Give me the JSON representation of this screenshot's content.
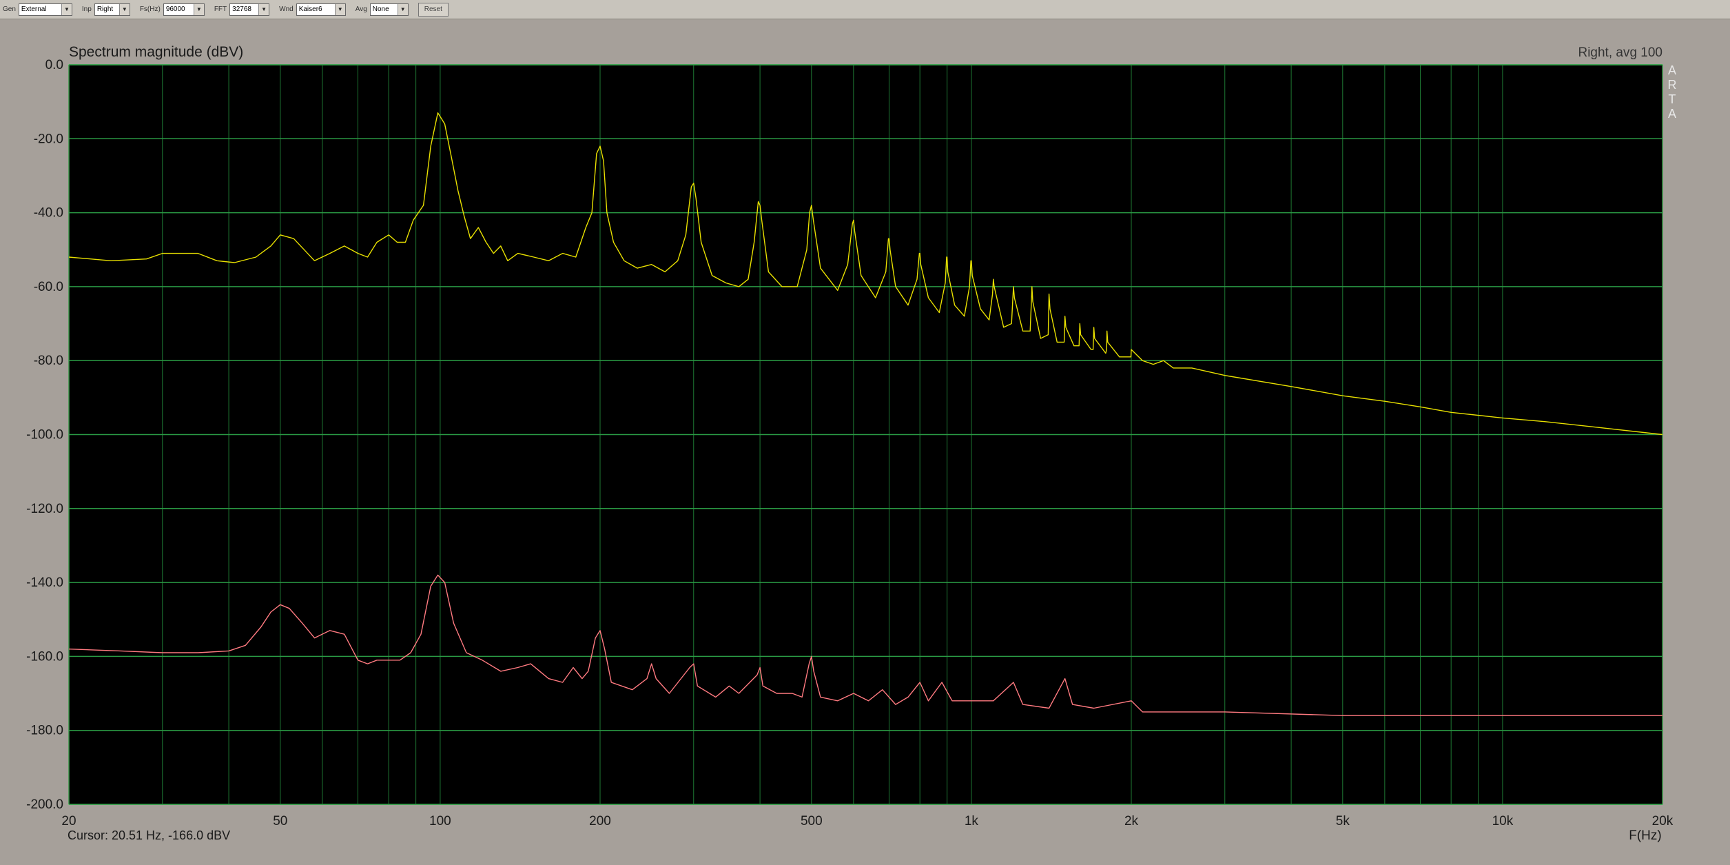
{
  "toolbar": {
    "groups": [
      {
        "label": "Gen",
        "value": "External"
      },
      {
        "label": "Inp",
        "value": "Right"
      },
      {
        "label": "Fs(Hz)",
        "value": "96000"
      },
      {
        "label": "FFT",
        "value": "32768"
      },
      {
        "label": "Wnd",
        "value": "Kaiser6"
      },
      {
        "label": "Avg",
        "value": "None"
      }
    ],
    "reset_label": "Reset"
  },
  "chart_data": {
    "type": "line",
    "title": "Spectrum magnitude (dBV)",
    "channel_label": "Right, avg 100",
    "watermark": "ARTA",
    "xlabel": "F(Hz)",
    "xscale": "log",
    "xlim": [
      20,
      20000
    ],
    "ylim": [
      -200,
      0
    ],
    "grid": true,
    "y_ticks": [
      "0.0",
      "-20.0",
      "-40.0",
      "-60.0",
      "-80.0",
      "-100.0",
      "-120.0",
      "-140.0",
      "-160.0",
      "-180.0",
      "-200.0"
    ],
    "x_ticks": [
      {
        "value": 20,
        "label": "20"
      },
      {
        "value": 50,
        "label": "50"
      },
      {
        "value": 100,
        "label": "100"
      },
      {
        "value": 200,
        "label": "200"
      },
      {
        "value": 500,
        "label": "500"
      },
      {
        "value": 1000,
        "label": "1k"
      },
      {
        "value": 2000,
        "label": "2k"
      },
      {
        "value": 5000,
        "label": "5k"
      },
      {
        "value": 10000,
        "label": "10k"
      },
      {
        "value": 20000,
        "label": "20k"
      }
    ],
    "cursor_text": "Cursor: 20.51 Hz, -166.0 dBV",
    "series": [
      {
        "color": "#e8e000",
        "points": [
          [
            20,
            -52
          ],
          [
            24,
            -53
          ],
          [
            28,
            -52.5
          ],
          [
            30,
            -51
          ],
          [
            35,
            -51
          ],
          [
            38,
            -53
          ],
          [
            41,
            -53.5
          ],
          [
            45,
            -52
          ],
          [
            48,
            -49
          ],
          [
            50,
            -46
          ],
          [
            53,
            -47
          ],
          [
            58,
            -53
          ],
          [
            62,
            -51
          ],
          [
            66,
            -49
          ],
          [
            70,
            -51
          ],
          [
            73,
            -52
          ],
          [
            76,
            -48
          ],
          [
            80,
            -46
          ],
          [
            83,
            -48
          ],
          [
            86,
            -48
          ],
          [
            89,
            -42
          ],
          [
            93,
            -38
          ],
          [
            96,
            -22
          ],
          [
            99,
            -13
          ],
          [
            102,
            -16
          ],
          [
            105,
            -25
          ],
          [
            108,
            -34
          ],
          [
            111,
            -41
          ],
          [
            114,
            -47
          ],
          [
            118,
            -44
          ],
          [
            122,
            -48
          ],
          [
            126,
            -51
          ],
          [
            130,
            -49
          ],
          [
            134,
            -53
          ],
          [
            140,
            -51
          ],
          [
            150,
            -52
          ],
          [
            160,
            -53
          ],
          [
            170,
            -51
          ],
          [
            180,
            -52
          ],
          [
            188,
            -44
          ],
          [
            193,
            -40
          ],
          [
            197,
            -24
          ],
          [
            200,
            -22
          ],
          [
            203,
            -26
          ],
          [
            206,
            -40
          ],
          [
            212,
            -48
          ],
          [
            222,
            -53
          ],
          [
            235,
            -55
          ],
          [
            250,
            -54
          ],
          [
            265,
            -56
          ],
          [
            280,
            -53
          ],
          [
            290,
            -46
          ],
          [
            297,
            -33
          ],
          [
            300,
            -32
          ],
          [
            303,
            -36
          ],
          [
            310,
            -48
          ],
          [
            325,
            -57
          ],
          [
            345,
            -59
          ],
          [
            365,
            -60
          ],
          [
            380,
            -58
          ],
          [
            390,
            -48
          ],
          [
            397,
            -37
          ],
          [
            400,
            -38
          ],
          [
            403,
            -42
          ],
          [
            415,
            -56
          ],
          [
            440,
            -60
          ],
          [
            470,
            -60
          ],
          [
            490,
            -50
          ],
          [
            496,
            -40
          ],
          [
            500,
            -38
          ],
          [
            504,
            -42
          ],
          [
            520,
            -55
          ],
          [
            560,
            -61
          ],
          [
            585,
            -54
          ],
          [
            597,
            -43
          ],
          [
            600,
            -42
          ],
          [
            603,
            -45
          ],
          [
            620,
            -57
          ],
          [
            660,
            -63
          ],
          [
            690,
            -56
          ],
          [
            698,
            -47
          ],
          [
            700,
            -47
          ],
          [
            703,
            -50
          ],
          [
            720,
            -60
          ],
          [
            760,
            -65
          ],
          [
            790,
            -58
          ],
          [
            798,
            -51
          ],
          [
            800,
            -51
          ],
          [
            803,
            -54
          ],
          [
            830,
            -63
          ],
          [
            870,
            -67
          ],
          [
            893,
            -59
          ],
          [
            898,
            -52
          ],
          [
            900,
            -52
          ],
          [
            903,
            -56
          ],
          [
            930,
            -65
          ],
          [
            970,
            -68
          ],
          [
            992,
            -60
          ],
          [
            998,
            -53
          ],
          [
            1000,
            -53
          ],
          [
            1004,
            -57
          ],
          [
            1040,
            -66
          ],
          [
            1080,
            -69
          ],
          [
            1096,
            -62
          ],
          [
            1100,
            -58
          ],
          [
            1104,
            -60
          ],
          [
            1150,
            -71
          ],
          [
            1190,
            -70
          ],
          [
            1197,
            -63
          ],
          [
            1200,
            -60
          ],
          [
            1205,
            -63
          ],
          [
            1250,
            -72
          ],
          [
            1290,
            -72
          ],
          [
            1297,
            -64
          ],
          [
            1300,
            -60
          ],
          [
            1305,
            -64
          ],
          [
            1350,
            -74
          ],
          [
            1395,
            -73
          ],
          [
            1400,
            -62
          ],
          [
            1406,
            -66
          ],
          [
            1450,
            -75
          ],
          [
            1495,
            -75
          ],
          [
            1500,
            -68
          ],
          [
            1506,
            -71
          ],
          [
            1560,
            -76
          ],
          [
            1595,
            -76
          ],
          [
            1600,
            -70
          ],
          [
            1606,
            -73
          ],
          [
            1680,
            -77
          ],
          [
            1695,
            -77
          ],
          [
            1700,
            -71
          ],
          [
            1706,
            -74
          ],
          [
            1790,
            -78
          ],
          [
            1797,
            -77
          ],
          [
            1800,
            -72
          ],
          [
            1806,
            -75
          ],
          [
            1900,
            -79
          ],
          [
            1997,
            -79
          ],
          [
            2000,
            -77
          ],
          [
            2100,
            -80
          ],
          [
            2200,
            -81
          ],
          [
            2300,
            -80
          ],
          [
            2400,
            -82
          ],
          [
            2600,
            -82
          ],
          [
            3000,
            -84
          ],
          [
            4000,
            -87
          ],
          [
            5000,
            -89.5
          ],
          [
            6000,
            -91
          ],
          [
            7000,
            -92.5
          ],
          [
            8000,
            -94
          ],
          [
            10000,
            -95.5
          ],
          [
            12000,
            -96.5
          ],
          [
            15000,
            -98
          ],
          [
            20000,
            -100
          ]
        ]
      },
      {
        "color": "#ff7a80",
        "points": [
          [
            20,
            -158
          ],
          [
            25,
            -158.5
          ],
          [
            30,
            -159
          ],
          [
            35,
            -159
          ],
          [
            40,
            -158.5
          ],
          [
            43,
            -157
          ],
          [
            46,
            -152
          ],
          [
            48,
            -148
          ],
          [
            50,
            -146
          ],
          [
            52,
            -147
          ],
          [
            55,
            -151
          ],
          [
            58,
            -155
          ],
          [
            62,
            -153
          ],
          [
            66,
            -154
          ],
          [
            70,
            -161
          ],
          [
            73,
            -162
          ],
          [
            76,
            -161
          ],
          [
            80,
            -161
          ],
          [
            84,
            -161
          ],
          [
            88,
            -159
          ],
          [
            92,
            -154
          ],
          [
            96,
            -141
          ],
          [
            99,
            -138
          ],
          [
            102,
            -140
          ],
          [
            106,
            -151
          ],
          [
            112,
            -159
          ],
          [
            120,
            -161
          ],
          [
            130,
            -164
          ],
          [
            140,
            -163
          ],
          [
            148,
            -162
          ],
          [
            160,
            -166
          ],
          [
            170,
            -167
          ],
          [
            178,
            -163
          ],
          [
            185,
            -166
          ],
          [
            190,
            -164
          ],
          [
            196,
            -155
          ],
          [
            200,
            -153
          ],
          [
            204,
            -158
          ],
          [
            210,
            -167
          ],
          [
            230,
            -169
          ],
          [
            245,
            -166
          ],
          [
            250,
            -162
          ],
          [
            255,
            -166
          ],
          [
            270,
            -170
          ],
          [
            295,
            -163
          ],
          [
            300,
            -162
          ],
          [
            305,
            -168
          ],
          [
            330,
            -171
          ],
          [
            350,
            -168
          ],
          [
            365,
            -170
          ],
          [
            395,
            -165
          ],
          [
            400,
            -163
          ],
          [
            405,
            -168
          ],
          [
            430,
            -170
          ],
          [
            460,
            -170
          ],
          [
            480,
            -171
          ],
          [
            495,
            -162
          ],
          [
            500,
            -160
          ],
          [
            505,
            -164
          ],
          [
            520,
            -171
          ],
          [
            560,
            -172
          ],
          [
            600,
            -170
          ],
          [
            640,
            -172
          ],
          [
            680,
            -169
          ],
          [
            720,
            -173
          ],
          [
            760,
            -171
          ],
          [
            800,
            -167
          ],
          [
            830,
            -172
          ],
          [
            880,
            -167
          ],
          [
            920,
            -172
          ],
          [
            1000,
            -172
          ],
          [
            1100,
            -172
          ],
          [
            1200,
            -167
          ],
          [
            1250,
            -173
          ],
          [
            1400,
            -174
          ],
          [
            1500,
            -166
          ],
          [
            1550,
            -173
          ],
          [
            1700,
            -174
          ],
          [
            2000,
            -172
          ],
          [
            2100,
            -175
          ],
          [
            3000,
            -175
          ],
          [
            5000,
            -176
          ],
          [
            10000,
            -176
          ],
          [
            20000,
            -176
          ]
        ]
      }
    ]
  }
}
